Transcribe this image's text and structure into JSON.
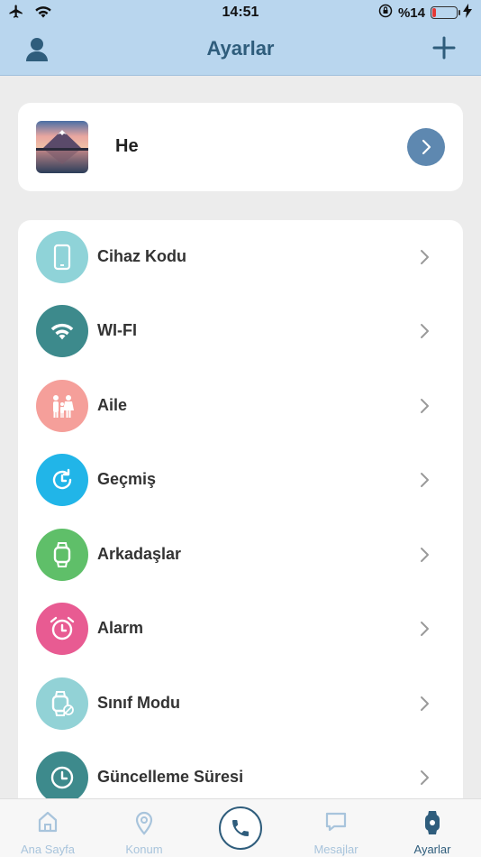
{
  "status_bar": {
    "time": "14:51",
    "battery_text": "%14",
    "battery_level_percent": 14,
    "icons": [
      "airplane-icon",
      "wifi-icon",
      "orientation-lock-icon",
      "battery-icon",
      "charging-icon"
    ]
  },
  "header": {
    "title": "Ayarlar",
    "left_icon": "user-icon",
    "right_icon": "plus-icon"
  },
  "profile": {
    "name": "He",
    "photo": "mountain-landscape-photo",
    "action_icon": "chevron-right-icon"
  },
  "menu": {
    "items": [
      {
        "label": "Cihaz Kodu",
        "icon": "device-icon",
        "color": "#8fd3d8"
      },
      {
        "label": "WI-FI",
        "icon": "wifi-icon",
        "color": "#3d8a8c"
      },
      {
        "label": "Aile",
        "icon": "family-icon",
        "color": "#f59f9a"
      },
      {
        "label": "Geçmiş",
        "icon": "history-icon",
        "color": "#21b5e8"
      },
      {
        "label": "Arkadaşlar",
        "icon": "watch-icon",
        "color": "#5fbf69"
      },
      {
        "label": "Alarm",
        "icon": "alarm-icon",
        "color": "#e85b92"
      },
      {
        "label": "Sınıf Modu",
        "icon": "class-mode-watch-icon",
        "color": "#92d2d6"
      },
      {
        "label": "Güncelleme Süresi",
        "icon": "clock-icon",
        "color": "#3d8a8c"
      }
    ]
  },
  "tab_bar": {
    "tabs": [
      {
        "label": "Ana Sayfa",
        "icon": "home-icon",
        "active": false
      },
      {
        "label": "Konum",
        "icon": "location-pin-icon",
        "active": false
      },
      {
        "label": "Mesajlar",
        "icon": "chat-icon",
        "active": false
      },
      {
        "label": "Ayarlar",
        "icon": "watch-settings-icon",
        "active": true
      }
    ],
    "center_button_icon": "phone-icon"
  },
  "colors": {
    "header_bg": "#b9d6ee",
    "title": "#2f5d7c",
    "inactive_tab": "#a8c4dc",
    "active_tab": "#2f5d7c",
    "profile_button": "#5e88b0",
    "page_bg": "#ececec"
  }
}
